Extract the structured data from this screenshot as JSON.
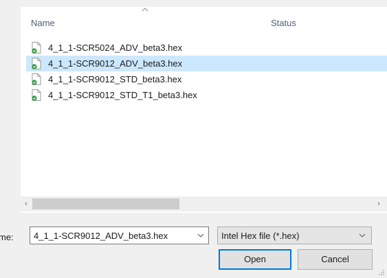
{
  "columns": {
    "name": "Name",
    "status": "Status"
  },
  "files": [
    {
      "name": "4_1_1-SCR5024_ADV_beta3.hex",
      "selected": false,
      "icon": "hex-file-icon"
    },
    {
      "name": "4_1_1-SCR9012_ADV_beta3.hex",
      "selected": true,
      "icon": "hex-file-icon"
    },
    {
      "name": "4_1_1-SCR9012_STD_beta3.hex",
      "selected": false,
      "icon": "hex-file-icon"
    },
    {
      "name": "4_1_1-SCR9012_STD_T1_beta3.hex",
      "selected": false,
      "icon": "hex-file-icon"
    }
  ],
  "scrollbar": {
    "left_arrow": "‹",
    "right_arrow": "›"
  },
  "filename": {
    "label": "me:",
    "value": "4_1_1-SCR9012_ADV_beta3.hex"
  },
  "filetype": {
    "selected": "Intel Hex file (*.hex)"
  },
  "buttons": {
    "open": "Open",
    "cancel": "Cancel"
  },
  "colors": {
    "selection": "#cce8ff",
    "accent": "#0078d7",
    "header_text": "#4c607a"
  }
}
